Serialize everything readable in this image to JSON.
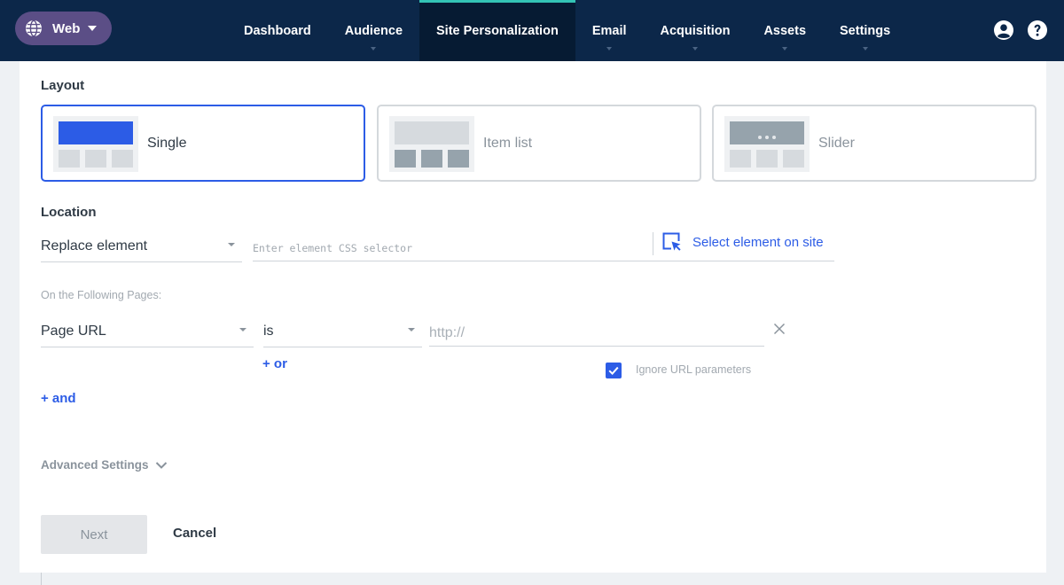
{
  "topbar": {
    "channel": {
      "label": "Web",
      "icon": "globe-icon"
    },
    "nav": [
      {
        "label": "Dashboard",
        "has_menu": false,
        "active": false
      },
      {
        "label": "Audience",
        "has_menu": true,
        "active": false
      },
      {
        "label": "Site Personalization",
        "has_menu": false,
        "active": true
      },
      {
        "label": "Email",
        "has_menu": true,
        "active": false
      },
      {
        "label": "Acquisition",
        "has_menu": true,
        "active": false
      },
      {
        "label": "Assets",
        "has_menu": true,
        "active": false
      },
      {
        "label": "Settings",
        "has_menu": true,
        "active": false
      }
    ],
    "icons": [
      "user-icon",
      "help-icon"
    ],
    "active_accent": "#33c3b5",
    "background": "#0c2749"
  },
  "layout": {
    "title": "Layout",
    "options": [
      {
        "label": "Single",
        "selected": true
      },
      {
        "label": "Item list",
        "selected": false
      },
      {
        "label": "Slider",
        "selected": false
      }
    ]
  },
  "location": {
    "title": "Location",
    "method": "Replace element",
    "selector_placeholder": "Enter element CSS selector",
    "select_on_site_label": "Select element on site"
  },
  "pages": {
    "label": "On the Following Pages:",
    "rule": {
      "field": "Page URL",
      "operator": "is",
      "value_placeholder": "http://",
      "value": ""
    },
    "or_label": "+ or",
    "ignore_params_label": "Ignore URL parameters",
    "ignore_params_checked": true,
    "and_label": "+ and"
  },
  "advanced": {
    "label": "Advanced Settings"
  },
  "actions": {
    "next_label": "Next",
    "cancel_label": "Cancel"
  },
  "colors": {
    "primary": "#2c5ce6",
    "text": "#2f3a45",
    "muted": "#a2a9b0"
  }
}
